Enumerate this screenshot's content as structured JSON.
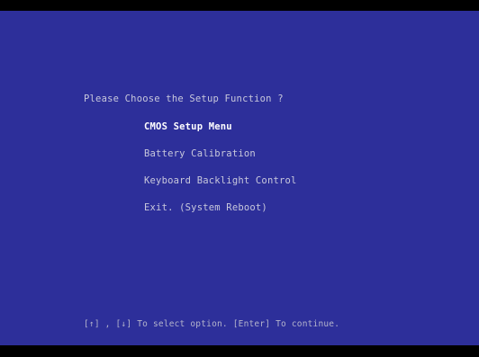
{
  "screen": {
    "prompt": "Please Choose the Setup Function ?",
    "menu_items": [
      {
        "label": "CMOS Setup Menu",
        "selected": true
      },
      {
        "label": "Battery Calibration",
        "selected": false
      },
      {
        "label": "Keyboard Backlight Control",
        "selected": false
      },
      {
        "label": "Exit. (System Reboot)",
        "selected": false
      }
    ],
    "footer_hint": "[↑] , [↓]  To select option.  [Enter] To continue."
  },
  "colors": {
    "background": "#2d2f9a",
    "text": "#c8c8dc",
    "selected_text": "#ffffff"
  }
}
